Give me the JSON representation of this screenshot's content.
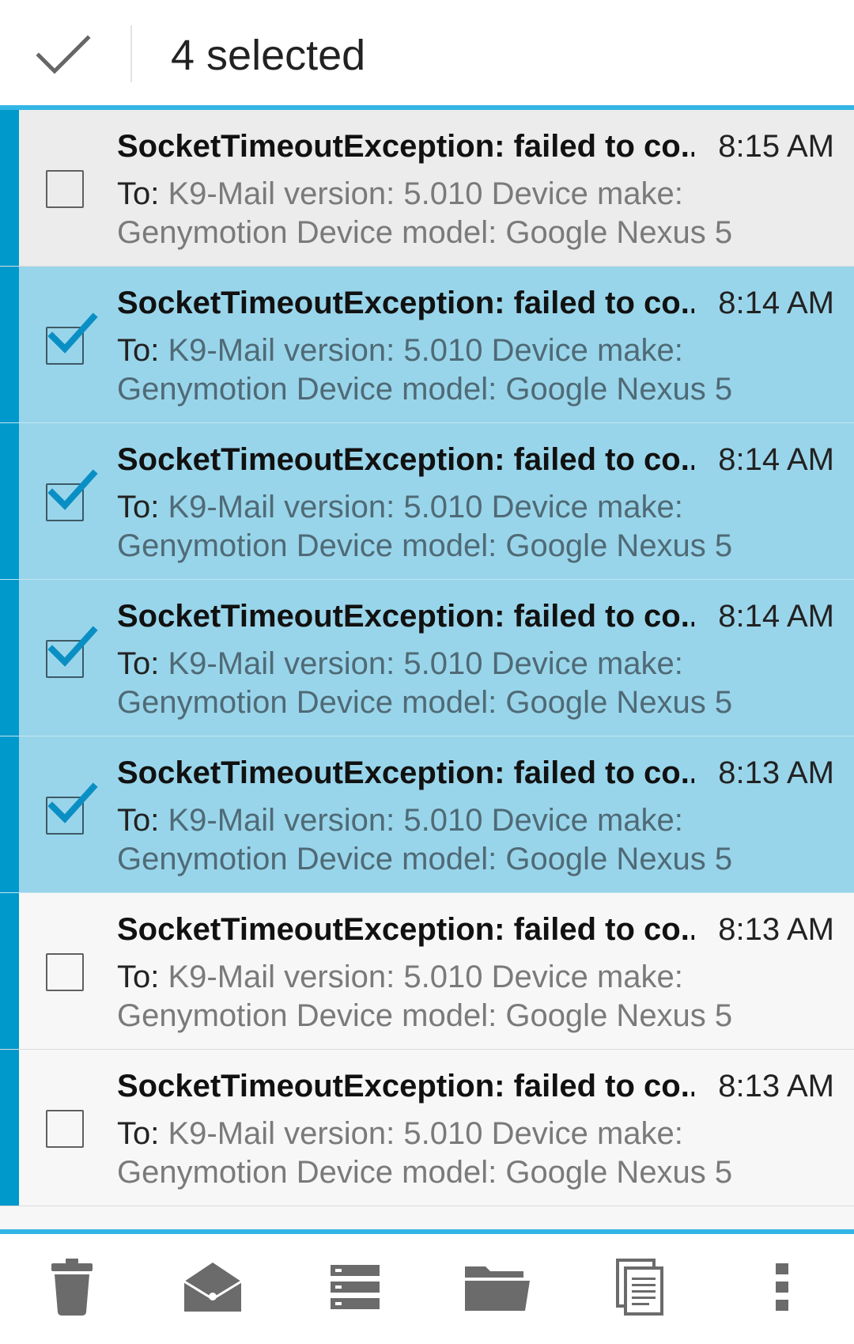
{
  "action_bar": {
    "title": "4 selected",
    "done_icon": "checkmark-done-icon"
  },
  "messages": [
    {
      "subject": "SocketTimeoutException: failed to co..",
      "time": "8:15 AM",
      "to_label": "To:",
      "preview_line1": "K9-Mail version: 5.010 Device make:",
      "preview_line2": "Genymotion Device model: Google Nexus 5",
      "selected": false
    },
    {
      "subject": "SocketTimeoutException: failed to co..",
      "time": "8:14 AM",
      "to_label": "To:",
      "preview_line1": "K9-Mail version: 5.010 Device make:",
      "preview_line2": "Genymotion Device model: Google Nexus 5",
      "selected": true
    },
    {
      "subject": "SocketTimeoutException: failed to co..",
      "time": "8:14 AM",
      "to_label": "To:",
      "preview_line1": "K9-Mail version: 5.010 Device make:",
      "preview_line2": "Genymotion Device model: Google Nexus 5",
      "selected": true
    },
    {
      "subject": "SocketTimeoutException: failed to co..",
      "time": "8:14 AM",
      "to_label": "To:",
      "preview_line1": "K9-Mail version: 5.010 Device make:",
      "preview_line2": "Genymotion Device model: Google Nexus 5",
      "selected": true
    },
    {
      "subject": "SocketTimeoutException: failed to co..",
      "time": "8:13 AM",
      "to_label": "To:",
      "preview_line1": "K9-Mail version: 5.010 Device make:",
      "preview_line2": "Genymotion Device model: Google Nexus 5",
      "selected": true
    },
    {
      "subject": "SocketTimeoutException: failed to co..",
      "time": "8:13 AM",
      "to_label": "To:",
      "preview_line1": "K9-Mail version: 5.010 Device make:",
      "preview_line2": "Genymotion Device model: Google Nexus 5",
      "selected": false
    },
    {
      "subject": "SocketTimeoutException: failed to co..",
      "time": "8:13 AM",
      "to_label": "To:",
      "preview_line1": "K9-Mail version: 5.010 Device make:",
      "preview_line2": "Genymotion Device model: Google Nexus 5",
      "selected": false
    }
  ],
  "bottom_actions": [
    {
      "icon": "trash-icon"
    },
    {
      "icon": "mark-read-envelope-icon"
    },
    {
      "icon": "archive-stack-icon"
    },
    {
      "icon": "move-to-folder-icon"
    },
    {
      "icon": "copy-icon"
    },
    {
      "icon": "overflow-menu-icon"
    }
  ],
  "colors": {
    "accent": "#33b5e5",
    "account_stripe": "#0099cc",
    "selected_row": "#99d5ea",
    "check_tick": "#0a8fc4",
    "icon_gray": "#6b6b6b"
  }
}
